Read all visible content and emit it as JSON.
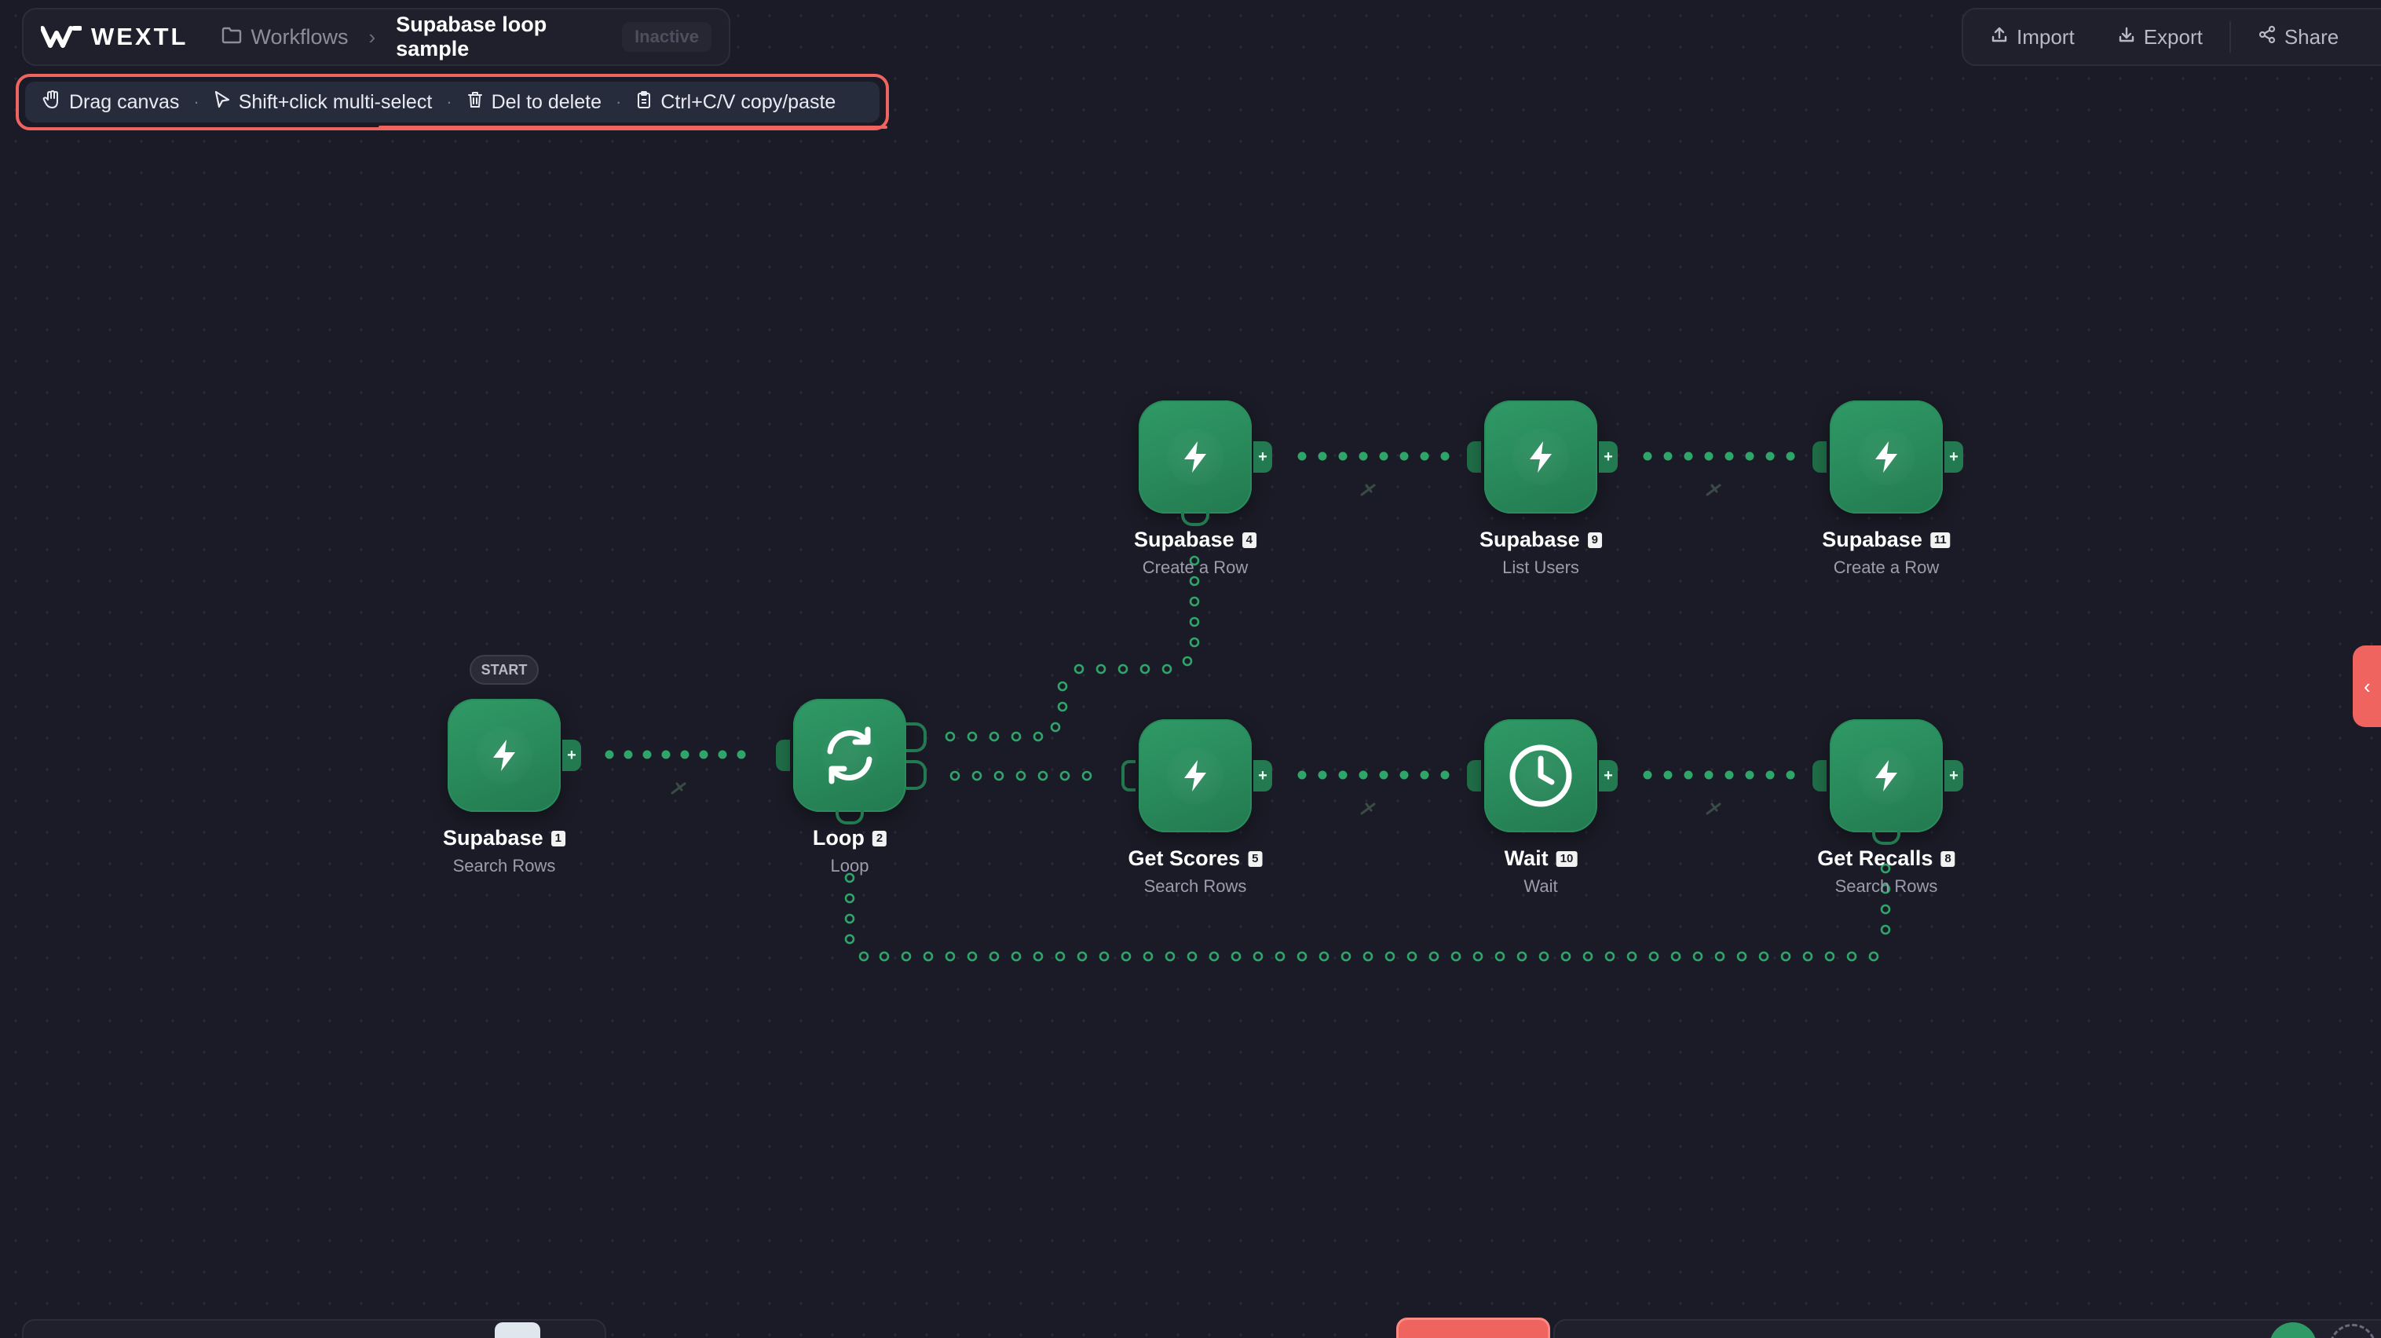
{
  "brand": {
    "name": "WEXTL"
  },
  "breadcrumb": {
    "section": "Workflows",
    "workflow_title": "Supabase loop sample",
    "status": "Inactive"
  },
  "actions": {
    "import": "Import",
    "export": "Export",
    "share": "Share"
  },
  "hints": {
    "drag": "Drag canvas",
    "multi": "Shift+click multi-select",
    "delete": "Del to delete",
    "copy": "Ctrl+C/V copy/paste"
  },
  "canvas": {
    "start_badge": "START",
    "nodes": [
      {
        "id": "n1",
        "title": "Supabase",
        "num": "1",
        "sub": "Search Rows",
        "icon": "bolt-icon"
      },
      {
        "id": "n2",
        "title": "Loop",
        "num": "2",
        "sub": "Loop",
        "icon": "loop-icon"
      },
      {
        "id": "n4",
        "title": "Supabase",
        "num": "4",
        "sub": "Create a Row",
        "icon": "bolt-icon"
      },
      {
        "id": "n9",
        "title": "Supabase",
        "num": "9",
        "sub": "List Users",
        "icon": "bolt-icon"
      },
      {
        "id": "n11",
        "title": "Supabase",
        "num": "11",
        "sub": "Create a Row",
        "icon": "bolt-icon"
      },
      {
        "id": "n5",
        "title": "Get Scores",
        "num": "5",
        "sub": "Search Rows",
        "icon": "bolt-icon"
      },
      {
        "id": "n10",
        "title": "Wait",
        "num": "10",
        "sub": "Wait",
        "icon": "clock-icon"
      },
      {
        "id": "n8",
        "title": "Get Recalls",
        "num": "8",
        "sub": "Search Rows",
        "icon": "bolt-icon"
      }
    ]
  },
  "colors": {
    "accent": "#2f9a66",
    "highlight": "#f0645f",
    "background": "#1b1b27"
  }
}
